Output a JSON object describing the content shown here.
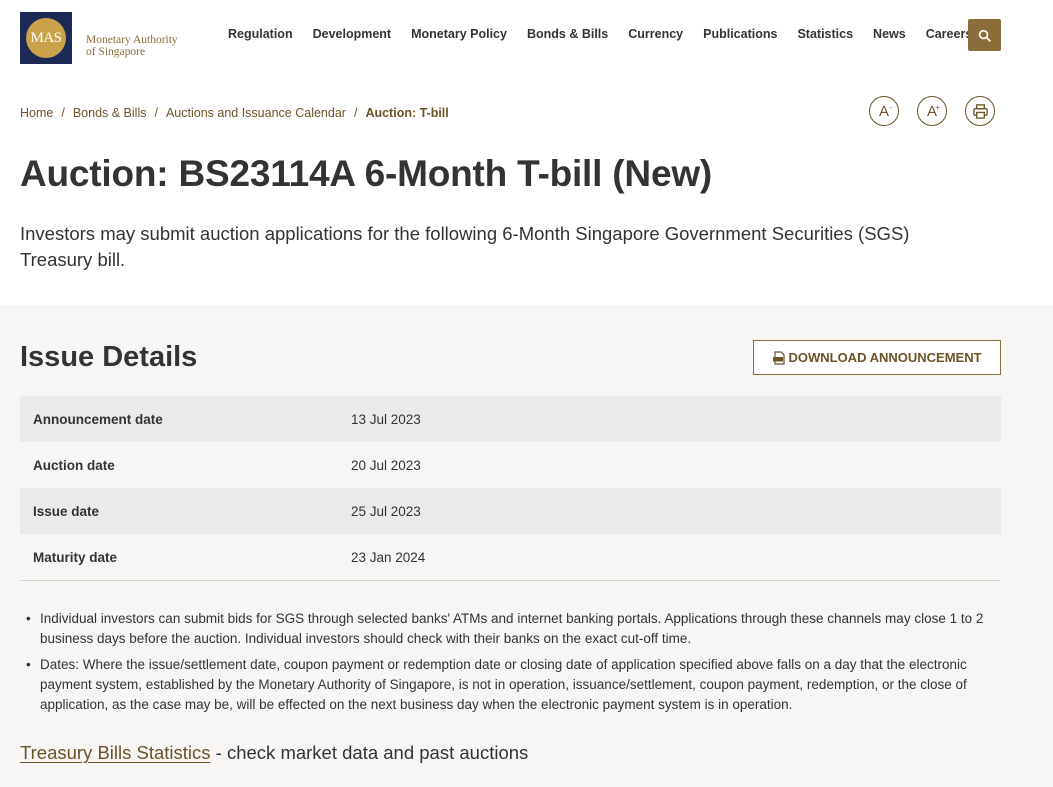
{
  "header": {
    "logo_mark": "MAS",
    "logo_line1": "Monetary Authority",
    "logo_line2": "of Singapore",
    "nav": [
      "Regulation",
      "Development",
      "Monetary Policy",
      "Bonds & Bills",
      "Currency",
      "Publications",
      "Statistics",
      "News",
      "Careers"
    ],
    "search_icon": "search-icon"
  },
  "breadcrumb": {
    "items": [
      "Home",
      "Bonds & Bills",
      "Auctions and Issuance Calendar",
      "Auction: T-bill"
    ],
    "separator": "/"
  },
  "tools": {
    "decrease_label": "A",
    "decrease_mark": "-",
    "increase_label": "A",
    "increase_mark": "+",
    "print_icon": "print-icon"
  },
  "page": {
    "title": "Auction: BS23114A 6-Month T-bill (New)",
    "intro": "Investors may submit auction applications for the following 6-Month Singapore Government Securities (SGS) Treasury bill."
  },
  "issue_details": {
    "title": "Issue Details",
    "download_label": "DOWNLOAD ANNOUNCEMENT",
    "pdf_icon": "pdf-icon",
    "rows": [
      {
        "label": "Announcement date",
        "value": "13 Jul 2023"
      },
      {
        "label": "Auction date",
        "value": "20 Jul 2023"
      },
      {
        "label": "Issue date",
        "value": "25 Jul 2023"
      },
      {
        "label": "Maturity date",
        "value": "23 Jan 2024"
      }
    ],
    "notes": [
      "Individual investors can submit bids for SGS through selected banks' ATMs and internet banking portals. Applications through these channels may close 1 to 2 business days before the auction. Individual investors should check with their banks on the exact cut-off time.",
      "Dates: Where the issue/settlement date, coupon payment or redemption date or closing date of application specified above falls on a day that the electronic payment system, established by the Monetary Authority of Singapore, is not in operation, issuance/settlement, coupon payment, redemption, or the close of application, as the case may be, will be effected on the next business day when the electronic payment system is in operation."
    ]
  },
  "stats": {
    "link_text": "Treasury Bills Statistics",
    "suffix": " - check market data and past auctions"
  },
  "colors": {
    "brand_gold": "#8a6d3b",
    "brand_navy": "#1c2a55",
    "section_bg": "#f7f6f5"
  }
}
